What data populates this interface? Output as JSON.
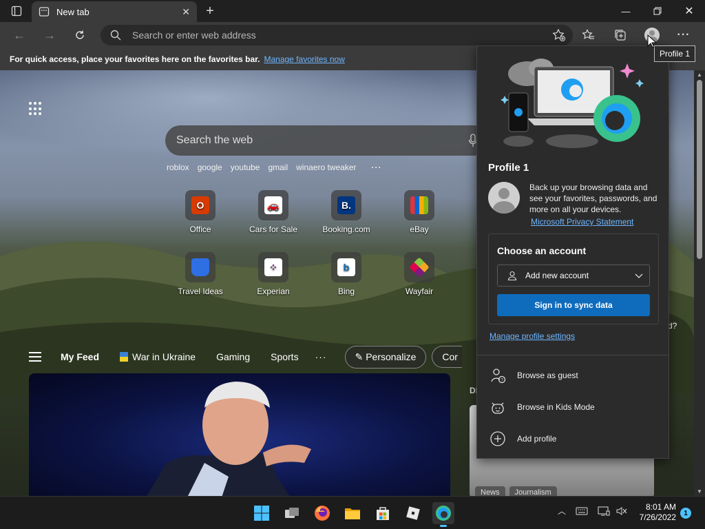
{
  "browser": {
    "tab_title": "New tab",
    "address_placeholder": "Search or enter web address",
    "favbar_text": "For quick access, place your favorites here on the favorites bar.",
    "favbar_link": "Manage favorites now",
    "tooltip": "Profile 1"
  },
  "newtab": {
    "search_placeholder": "Search the web",
    "suggestions": [
      "roblox",
      "google",
      "youtube",
      "gmail",
      "winaero tweaker"
    ],
    "suggestions_more": "···",
    "tiles": [
      {
        "label": "Office",
        "icon": "office-icon",
        "color": "#d83b01"
      },
      {
        "label": "Cars for Sale",
        "icon": "car-icon",
        "color": "#1a73e8"
      },
      {
        "label": "Booking.com",
        "icon": "booking-icon",
        "color": "#003580"
      },
      {
        "label": "eBay",
        "icon": "ebay-icon",
        "color": "#e53238"
      },
      {
        "label": "Travel Ideas",
        "icon": "bag-icon",
        "color": "#2f6fe4"
      },
      {
        "label": "Experian",
        "icon": "experian-icon",
        "color": "#6d2077"
      },
      {
        "label": "Bing",
        "icon": "bing-icon",
        "color": "#0f6cbd"
      },
      {
        "label": "Wayfair",
        "icon": "wayfair-icon",
        "color": "#7f187f"
      }
    ],
    "feed": {
      "my_feed": "My Feed",
      "tabs": [
        "War in Ukraine",
        "Gaming",
        "Sports"
      ],
      "more": "···",
      "personalize": "Personalize",
      "partial": "Cor"
    },
    "side_card_label": "DI",
    "side_card_chips": [
      "News",
      "Journalism"
    ],
    "side_text": "d?"
  },
  "profile_flyout": {
    "name": "Profile 1",
    "description": "Back up your browsing data and see your favorites, passwords, and more on all your devices.",
    "privacy_link": "Microsoft Privacy Statement",
    "choose_title": "Choose an account",
    "add_account": "Add new account",
    "sync_button": "Sign in to sync data",
    "manage_link": "Manage profile settings",
    "actions": [
      "Browse as guest",
      "Browse in Kids Mode",
      "Add profile"
    ]
  },
  "taskbar": {
    "time": "8:01 AM",
    "date": "7/26/2022",
    "notification_count": "1"
  },
  "colors": {
    "accent": "#0f6cbd",
    "link": "#6fb7ff",
    "edge_blue": "#1f9ff2",
    "edge_green": "#39c28c"
  }
}
